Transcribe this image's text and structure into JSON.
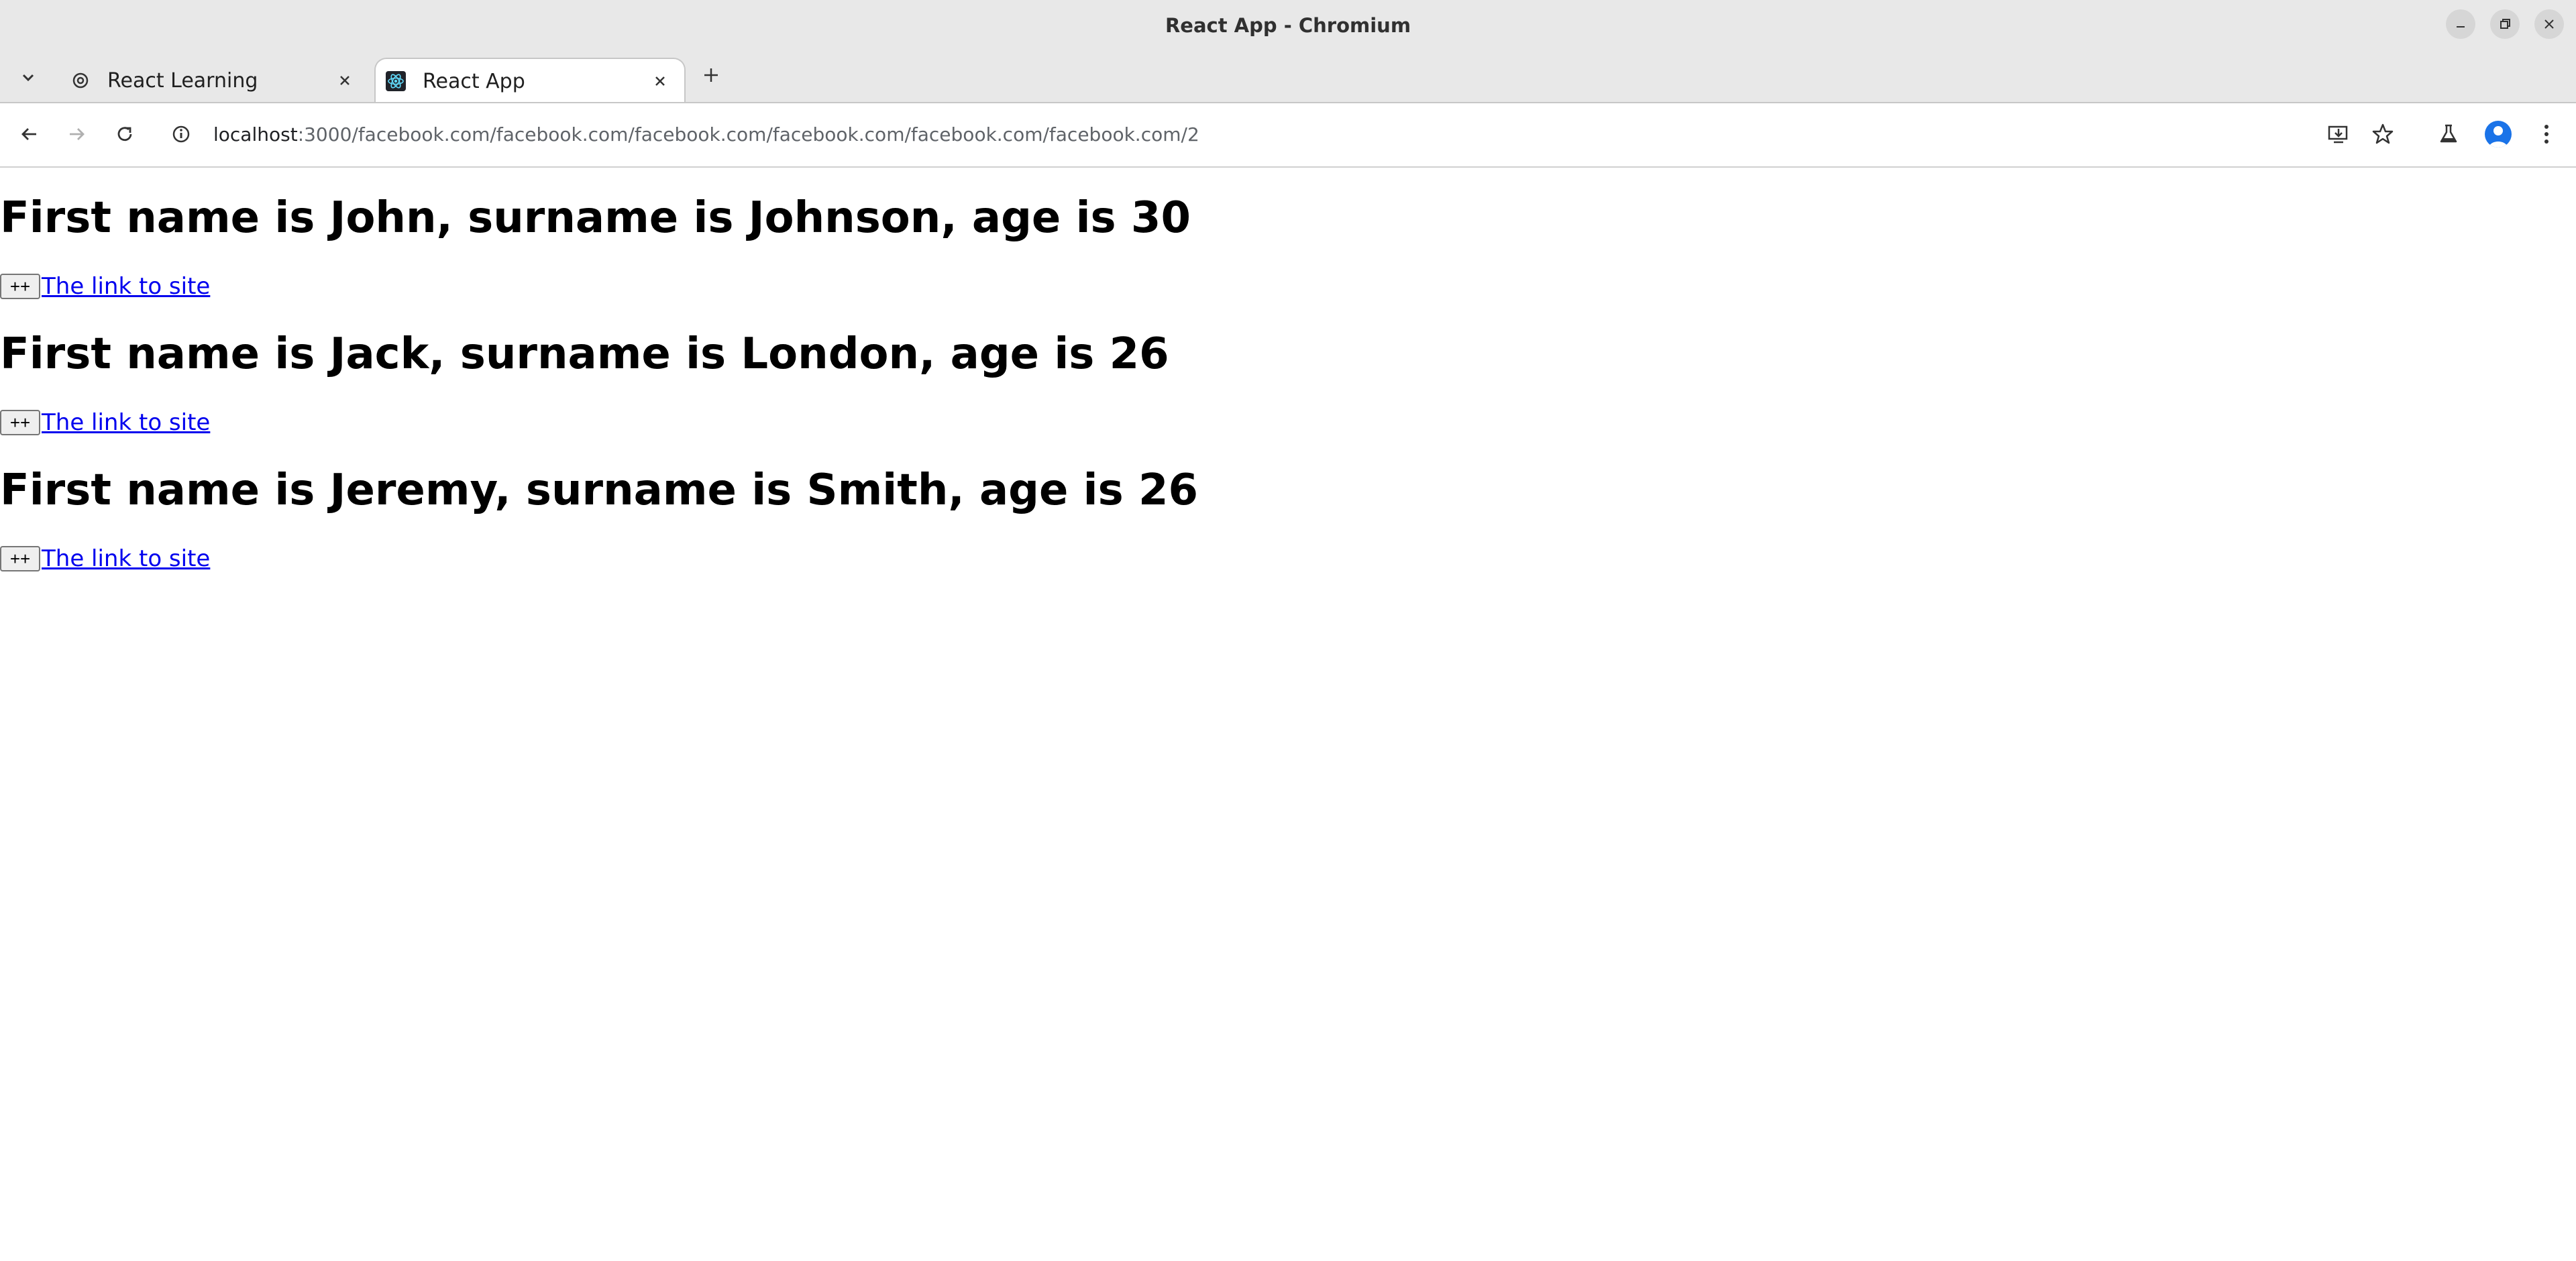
{
  "window": {
    "title": "React App - Chromium"
  },
  "tabs": [
    {
      "label": "React Learning",
      "active": false,
      "icon": "openai-icon"
    },
    {
      "label": "React App",
      "active": true,
      "icon": "react-icon"
    }
  ],
  "address_bar": {
    "host": "localhost",
    "path": ":3000/facebook.com/facebook.com/facebook.com/facebook.com/facebook.com/facebook.com/2"
  },
  "people": [
    {
      "heading": "First name is John, surname is Johnson, age is 30",
      "button_label": "++",
      "link_text": "The link to site"
    },
    {
      "heading": "First name is Jack, surname is London, age is 26",
      "button_label": "++",
      "link_text": "The link to site"
    },
    {
      "heading": "First name is Jeremy, surname is Smith, age is 26",
      "button_label": "++",
      "link_text": "The link to site"
    }
  ],
  "colors": {
    "link": "#0000ee",
    "titlebar": "#e8e8e8",
    "avatar": "#1a73e8"
  }
}
